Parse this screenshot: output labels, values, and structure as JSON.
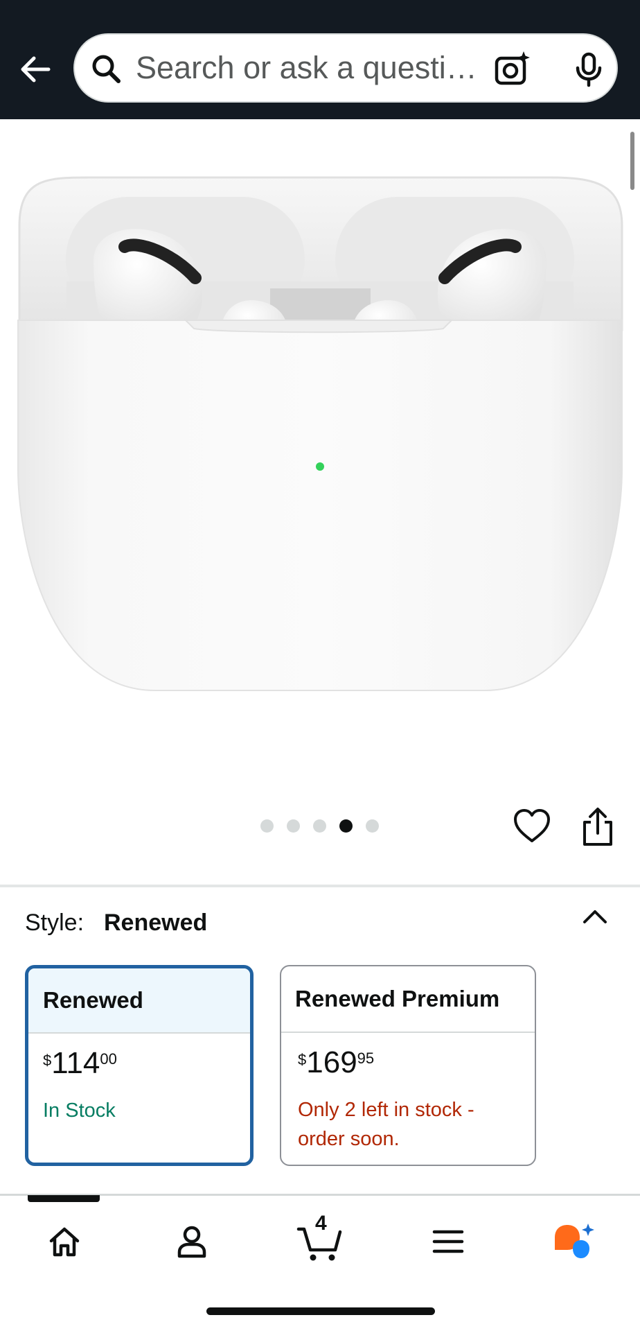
{
  "header": {
    "search_placeholder": "Search or ask a questi…"
  },
  "gallery": {
    "dot_count": 5,
    "active_index": 3
  },
  "style": {
    "label": "Style:",
    "selected": "Renewed"
  },
  "options": [
    {
      "name": "Renewed",
      "currency": "$",
      "price_whole": "114",
      "price_fraction": "00",
      "availability": "In Stock",
      "selected": true
    },
    {
      "name": "Renewed Premium",
      "currency": "$",
      "price_whole": "169",
      "price_fraction": "95",
      "availability": "Only 2 left in stock - order soon.",
      "selected": false
    }
  ],
  "tabbar": {
    "cart_count": "4"
  },
  "colors": {
    "header_bg": "#131a22",
    "selected_border": "#2162a1",
    "in_stock": "#067d62",
    "low_stock": "#b12704",
    "rufus_orange": "#ff6a1a",
    "rufus_blue": "#1c8bff"
  },
  "icons": [
    "back-arrow-icon",
    "search-icon",
    "camera-lens-icon",
    "microphone-icon",
    "heart-icon",
    "share-icon",
    "chevron-up-icon",
    "home-icon",
    "account-icon",
    "cart-icon",
    "menu-icon",
    "rufus-chat-icon"
  ]
}
